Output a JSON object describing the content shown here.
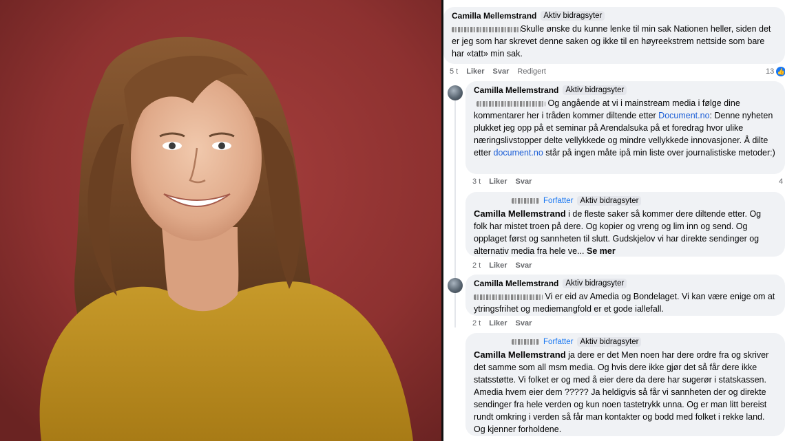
{
  "comments": [
    {
      "name": "Camilla Mellemstrand",
      "badge": "Aktiv bidragsyter",
      "text": "Skulle ønske du kunne lenke til min sak Nationen heller, siden det er jeg som har skrevet denne saken og ikke til en høyreekstrem nettside som bare har «tatt» min sak.",
      "time": "5 t",
      "like": "Liker",
      "reply": "Svar",
      "edited": "Redigert",
      "reaction_count": "13"
    },
    {
      "name": "Camilla Mellemstrand",
      "badge": "Aktiv bidragsyter",
      "text_a": "Og angående at vi i mainstream media i følge dine kommentarer her i tråden kommer diltende etter ",
      "link_a": "Document.no",
      "text_b": ": Denne nyheten plukket jeg opp på et seminar på Arendalsuka på et foredrag hvor ulike næringslivstopper delte vellykkede og mindre vellykkede innovasjoner. Å dilte etter ",
      "link_b": "document.no",
      "text_c": " står på ingen måte ipå min liste over journalistiske metoder:)",
      "time": "3 t",
      "like": "Liker",
      "reply": "Svar",
      "reaction_count": "4"
    },
    {
      "author_label": "Forfatter",
      "badge": "Aktiv bidragsyter",
      "mention": "Camilla Mellemstrand",
      "text": " i de fleste saker så kommer dere diltende etter. Og folk har mistet troen på dere. Og kopier og vreng og lim inn og send. Og opplaget først og sannheten til slutt. Gudskjelov vi har direkte sendinger og alternativ media fra hele ve...",
      "see_more": "Se mer",
      "time": "2 t",
      "like": "Liker",
      "reply": "Svar"
    },
    {
      "name": "Camilla Mellemstrand",
      "badge": "Aktiv bidragsyter",
      "text": "Vi er eid av Amedia og Bondelaget. Vi kan være enige om at ytringsfrihet og mediemangfold er et gode iallefall.",
      "time": "2 t",
      "like": "Liker",
      "reply": "Svar"
    },
    {
      "author_label": "Forfatter",
      "badge": "Aktiv bidragsyter",
      "mention": "Camilla Mellemstrand",
      "text": " ja dere er det Men noen har dere ordre fra og skriver det samme som all msm media. Og hvis dere ikke gjør det så får dere ikke statsstøtte. Vi folket er og med å eier dere da dere har sugerør i statskassen. Amedia hvem eier dem ????? Ja heldigvis så får vi sannheten der og direkte sendinger fra hele verden og kun noen tastetrykk unna. Og er man litt bereist rundt omkring i verden så får man kontakter og bodd med folket i rekke land. Og kjenner forholdene."
    }
  ]
}
